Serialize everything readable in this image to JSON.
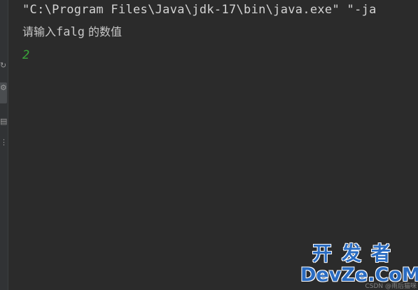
{
  "console": {
    "command_line": "\"C:\\Program Files\\Java\\jdk-17\\bin\\java.exe\" \"-ja",
    "prompt_cjk_a": "请输入",
    "prompt_var": "falg",
    "prompt_cjk_b": " 的数值",
    "user_input": "2"
  },
  "gutter": {
    "icons": [
      "rerun-icon",
      "wrench-icon",
      "print-icon",
      "more-icon"
    ]
  },
  "watermark": {
    "top": "开发者",
    "bottom": "DevZe.CoM",
    "credit": "CSDN @雨后猫咪"
  },
  "colors": {
    "background": "#2b2b2b",
    "text": "#d4d4d4",
    "input_green": "#3aa83a",
    "watermark_blue": "#2a6cc2"
  }
}
